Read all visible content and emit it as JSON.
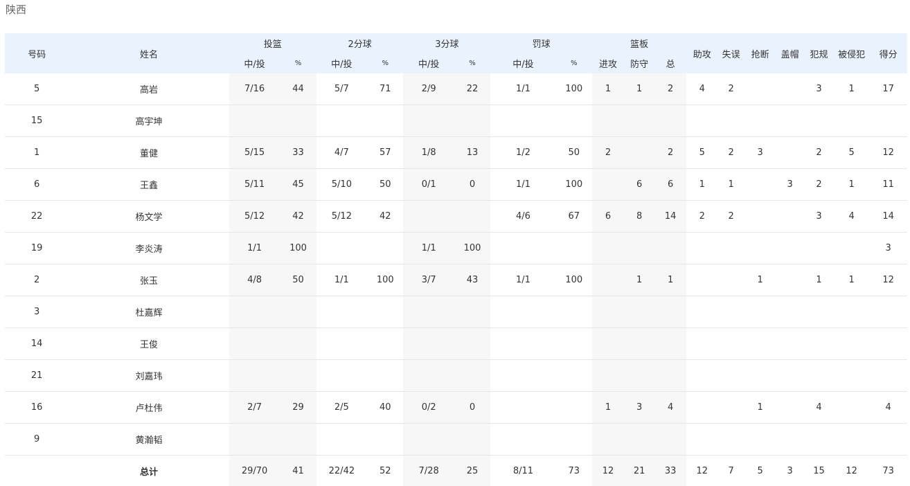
{
  "team_name": "陕西",
  "headers": {
    "number": "号码",
    "name": "姓名",
    "fg": "投篮",
    "two": "2分球",
    "three": "3分球",
    "ft": "罚球",
    "reb": "篮板",
    "made_att": "中/投",
    "pct": "%",
    "oreb": "进攻",
    "dreb": "防守",
    "treb": "总",
    "ast": "助攻",
    "tov": "失误",
    "stl": "抢断",
    "blk": "盖帽",
    "pf": "犯规",
    "fd": "被侵犯",
    "pts": "得分"
  },
  "players": [
    {
      "num": "5",
      "name": "高岩",
      "fg": "7/16",
      "fgp": "44",
      "two": "5/7",
      "twop": "71",
      "three": "2/9",
      "threep": "22",
      "ft": "1/1",
      "ftp": "100",
      "oreb": "1",
      "dreb": "1",
      "treb": "2",
      "ast": "4",
      "tov": "2",
      "stl": "",
      "blk": "",
      "pf": "3",
      "fd": "1",
      "pts": "17"
    },
    {
      "num": "15",
      "name": "高宇坤",
      "fg": "",
      "fgp": "",
      "two": "",
      "twop": "",
      "three": "",
      "threep": "",
      "ft": "",
      "ftp": "",
      "oreb": "",
      "dreb": "",
      "treb": "",
      "ast": "",
      "tov": "",
      "stl": "",
      "blk": "",
      "pf": "",
      "fd": "",
      "pts": ""
    },
    {
      "num": "1",
      "name": "董健",
      "fg": "5/15",
      "fgp": "33",
      "two": "4/7",
      "twop": "57",
      "three": "1/8",
      "threep": "13",
      "ft": "1/2",
      "ftp": "50",
      "oreb": "2",
      "dreb": "",
      "treb": "2",
      "ast": "5",
      "tov": "2",
      "stl": "3",
      "blk": "",
      "pf": "2",
      "fd": "5",
      "pts": "12"
    },
    {
      "num": "6",
      "name": "王鑫",
      "fg": "5/11",
      "fgp": "45",
      "two": "5/10",
      "twop": "50",
      "three": "0/1",
      "threep": "0",
      "ft": "1/1",
      "ftp": "100",
      "oreb": "",
      "dreb": "6",
      "treb": "6",
      "ast": "1",
      "tov": "1",
      "stl": "",
      "blk": "3",
      "pf": "2",
      "fd": "1",
      "pts": "11"
    },
    {
      "num": "22",
      "name": "杨文学",
      "fg": "5/12",
      "fgp": "42",
      "two": "5/12",
      "twop": "42",
      "three": "",
      "threep": "",
      "ft": "4/6",
      "ftp": "67",
      "oreb": "6",
      "dreb": "8",
      "treb": "14",
      "ast": "2",
      "tov": "2",
      "stl": "",
      "blk": "",
      "pf": "3",
      "fd": "4",
      "pts": "14"
    },
    {
      "num": "19",
      "name": "李炎涛",
      "fg": "1/1",
      "fgp": "100",
      "two": "",
      "twop": "",
      "three": "1/1",
      "threep": "100",
      "ft": "",
      "ftp": "",
      "oreb": "",
      "dreb": "",
      "treb": "",
      "ast": "",
      "tov": "",
      "stl": "",
      "blk": "",
      "pf": "",
      "fd": "",
      "pts": "3"
    },
    {
      "num": "2",
      "name": "张玉",
      "fg": "4/8",
      "fgp": "50",
      "two": "1/1",
      "twop": "100",
      "three": "3/7",
      "threep": "43",
      "ft": "1/1",
      "ftp": "100",
      "oreb": "",
      "dreb": "1",
      "treb": "1",
      "ast": "",
      "tov": "",
      "stl": "1",
      "blk": "",
      "pf": "1",
      "fd": "1",
      "pts": "12"
    },
    {
      "num": "3",
      "name": "杜嘉辉",
      "fg": "",
      "fgp": "",
      "two": "",
      "twop": "",
      "three": "",
      "threep": "",
      "ft": "",
      "ftp": "",
      "oreb": "",
      "dreb": "",
      "treb": "",
      "ast": "",
      "tov": "",
      "stl": "",
      "blk": "",
      "pf": "",
      "fd": "",
      "pts": ""
    },
    {
      "num": "14",
      "name": "王俊",
      "fg": "",
      "fgp": "",
      "two": "",
      "twop": "",
      "three": "",
      "threep": "",
      "ft": "",
      "ftp": "",
      "oreb": "",
      "dreb": "",
      "treb": "",
      "ast": "",
      "tov": "",
      "stl": "",
      "blk": "",
      "pf": "",
      "fd": "",
      "pts": ""
    },
    {
      "num": "21",
      "name": "刘嘉玮",
      "fg": "",
      "fgp": "",
      "two": "",
      "twop": "",
      "three": "",
      "threep": "",
      "ft": "",
      "ftp": "",
      "oreb": "",
      "dreb": "",
      "treb": "",
      "ast": "",
      "tov": "",
      "stl": "",
      "blk": "",
      "pf": "",
      "fd": "",
      "pts": ""
    },
    {
      "num": "16",
      "name": "卢杜伟",
      "fg": "2/7",
      "fgp": "29",
      "two": "2/5",
      "twop": "40",
      "three": "0/2",
      "threep": "0",
      "ft": "",
      "ftp": "",
      "oreb": "1",
      "dreb": "3",
      "treb": "4",
      "ast": "",
      "tov": "",
      "stl": "1",
      "blk": "",
      "pf": "4",
      "fd": "",
      "pts": "4"
    },
    {
      "num": "9",
      "name": "黄瀚韬",
      "fg": "",
      "fgp": "",
      "two": "",
      "twop": "",
      "three": "",
      "threep": "",
      "ft": "",
      "ftp": "",
      "oreb": "",
      "dreb": "",
      "treb": "",
      "ast": "",
      "tov": "",
      "stl": "",
      "blk": "",
      "pf": "",
      "fd": "",
      "pts": ""
    }
  ],
  "totals": {
    "num": "",
    "name": "总计",
    "fg": "29/70",
    "fgp": "41",
    "two": "22/42",
    "twop": "52",
    "three": "7/28",
    "threep": "25",
    "ft": "8/11",
    "ftp": "73",
    "oreb": "12",
    "dreb": "21",
    "treb": "33",
    "ast": "12",
    "tov": "7",
    "stl": "5",
    "blk": "3",
    "pf": "15",
    "fd": "12",
    "pts": "73"
  }
}
